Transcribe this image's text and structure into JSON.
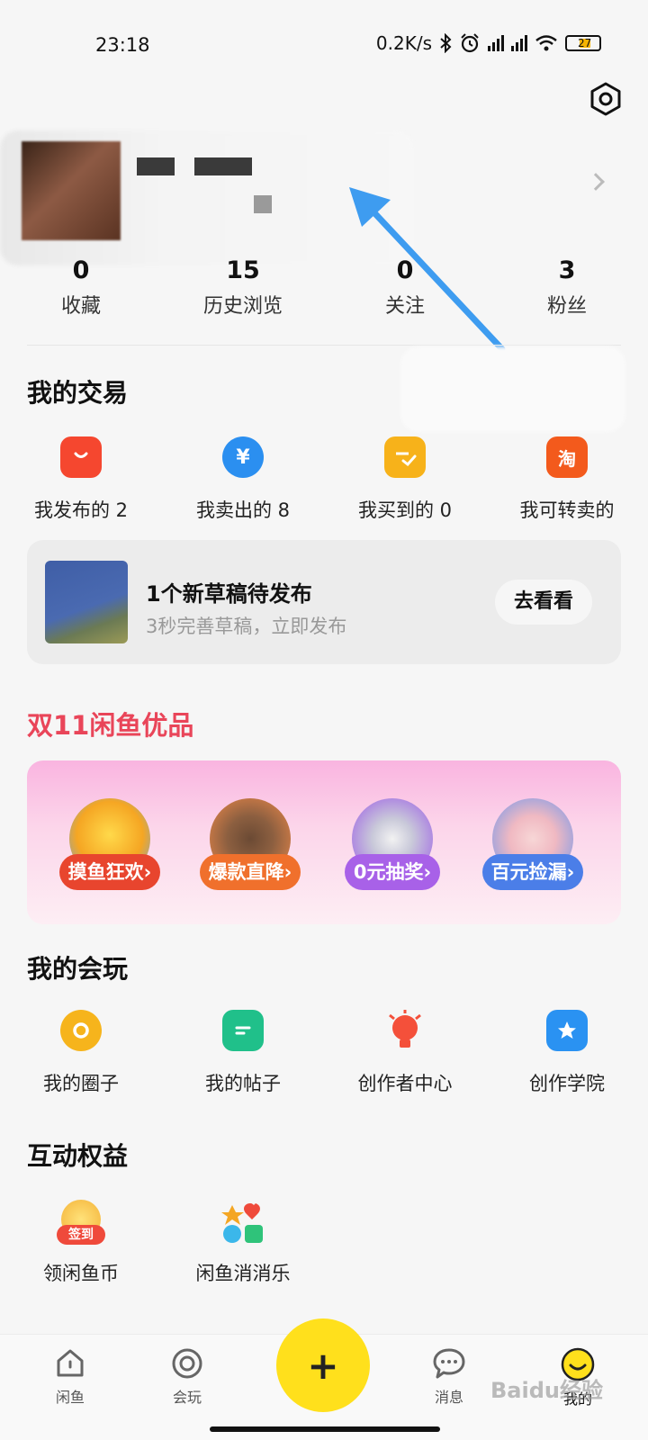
{
  "status_bar": {
    "time": "23:18",
    "network_speed": "0.2K/s",
    "battery_level": "27"
  },
  "profile": {
    "stats": [
      {
        "value": "0",
        "label": "收藏"
      },
      {
        "value": "15",
        "label": "历史浏览"
      },
      {
        "value": "0",
        "label": "关注"
      },
      {
        "value": "3",
        "label": "粉丝"
      }
    ]
  },
  "trade": {
    "title": "我的交易",
    "items": [
      {
        "label": "我发布的 2",
        "icon": "bag-icon",
        "color": "#f5472f"
      },
      {
        "label": "我卖出的 8",
        "icon": "yuan-icon",
        "color": "#2b8ff0",
        "glyph": "¥"
      },
      {
        "label": "我买到的 0",
        "icon": "check-icon",
        "color": "#f7b21a"
      },
      {
        "label": "我可转卖的",
        "icon": "taobao-icon",
        "color": "#f35a1c",
        "glyph": "淘"
      }
    ]
  },
  "draft": {
    "title": "1个新草稿待发布",
    "subtitle": "3秒完善草稿，立即发布",
    "button": "去看看"
  },
  "promo": {
    "title": "双11闲鱼优品",
    "items": [
      {
        "label": "摸鱼狂欢›",
        "color": "#e8452e"
      },
      {
        "label": "爆款直降›",
        "color": "#f0702c"
      },
      {
        "label": "0元抽奖›",
        "color": "#a861e8"
      },
      {
        "label": "百元捡漏›",
        "color": "#4b7ee8"
      }
    ]
  },
  "play": {
    "title": "我的会玩",
    "items": [
      {
        "label": "我的圈子",
        "icon": "circle-icon",
        "color": "#f6b41c"
      },
      {
        "label": "我的帖子",
        "icon": "post-icon",
        "color": "#20c08a"
      },
      {
        "label": "创作者中心",
        "icon": "bulb-icon",
        "color": "#f4503a"
      },
      {
        "label": "创作学院",
        "icon": "star-icon",
        "color": "#2a92f2"
      }
    ]
  },
  "benefits": {
    "title": "互动权益",
    "items": [
      {
        "label": "领闲鱼币",
        "icon": "coin-icon",
        "badge": "签到"
      },
      {
        "label": "闲鱼消消乐",
        "icon": "game-icon"
      }
    ]
  },
  "bottom_nav": {
    "items": [
      {
        "label": "闲鱼",
        "icon": "home-icon"
      },
      {
        "label": "会玩",
        "icon": "play-icon"
      },
      {
        "label": "消息",
        "icon": "message-icon"
      },
      {
        "label": "我的",
        "icon": "me-icon"
      }
    ],
    "publish": "+"
  },
  "watermark": "Baidu经验"
}
